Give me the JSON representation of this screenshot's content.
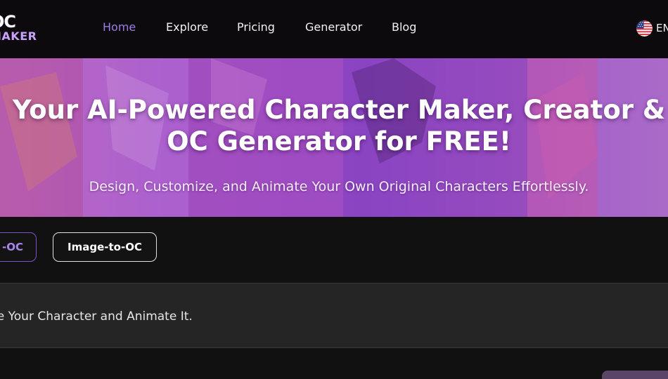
{
  "header": {
    "logo": {
      "line1": "OC",
      "line2": "MAKER"
    },
    "nav": [
      {
        "label": "Home",
        "active": true
      },
      {
        "label": "Explore",
        "active": false
      },
      {
        "label": "Pricing",
        "active": false
      },
      {
        "label": "Generator",
        "active": false
      },
      {
        "label": "Blog",
        "active": false
      }
    ],
    "language": {
      "code": "EN",
      "flag_icon": "us-flag-icon"
    }
  },
  "hero": {
    "title": "Your AI-Powered Character Maker, Creator & OC Generator for FREE!",
    "subtitle": "Design, Customize, and Animate Your Own Original Characters Effortlessly."
  },
  "modes": {
    "text_to_oc": "-OC",
    "image_to_oc": "Image-to-OC"
  },
  "prompt": {
    "placeholder": "be Your Character and Animate It."
  },
  "colors": {
    "accent": "#9e7ce9",
    "header_bg": "#0c0a0d",
    "page_bg": "#121112",
    "hero_tint": "#a45ee0"
  }
}
